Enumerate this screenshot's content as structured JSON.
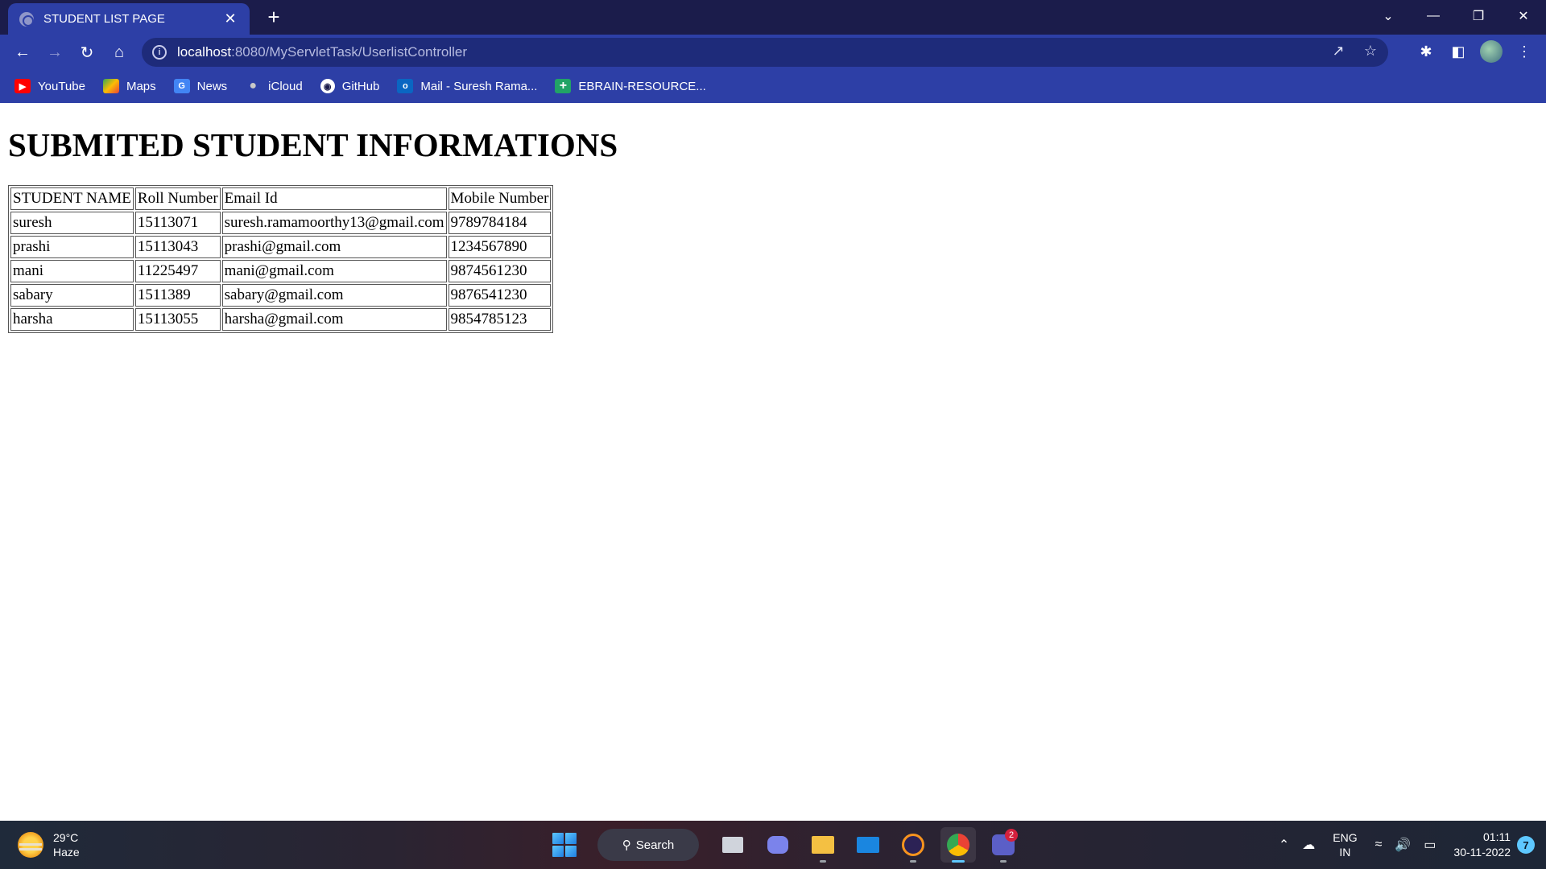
{
  "browser": {
    "tab_title": "STUDENT LIST PAGE",
    "tab_close": "✕",
    "new_tab": "+",
    "url_host": "localhost",
    "url_path": ":8080/MyServletTask/UserlistController"
  },
  "bookmarks": [
    {
      "label": "YouTube",
      "icon": "youtube-icon",
      "color": "#ff0000"
    },
    {
      "label": "Maps",
      "icon": "maps-icon",
      "color": "#34a853"
    },
    {
      "label": "News",
      "icon": "news-icon",
      "color": "#4285f4"
    },
    {
      "label": "iCloud",
      "icon": "apple-icon",
      "color": "#9aa0a6"
    },
    {
      "label": "GitHub",
      "icon": "github-icon",
      "color": "#ffffff"
    },
    {
      "label": "Mail - Suresh Rama...",
      "icon": "outlook-icon",
      "color": "#0a66c2"
    },
    {
      "label": "EBRAIN-RESOURCE...",
      "icon": "plus-green-icon",
      "color": "#21a366"
    }
  ],
  "page": {
    "heading": "SUBMITED STUDENT INFORMATIONS",
    "table": {
      "headers": [
        "STUDENT NAME",
        "Roll Number",
        "Email Id",
        "Mobile Number"
      ],
      "rows": [
        [
          "suresh",
          "15113071",
          "suresh.ramamoorthy13@gmail.com",
          "9789784184"
        ],
        [
          "prashi",
          "15113043",
          "prashi@gmail.com",
          "1234567890"
        ],
        [
          "mani",
          "11225497",
          "mani@gmail.com",
          "9874561230"
        ],
        [
          "sabary",
          "1511389",
          "sabary@gmail.com",
          "9876541230"
        ],
        [
          "harsha",
          "15113055",
          "harsha@gmail.com",
          "9854785123"
        ]
      ]
    }
  },
  "taskbar": {
    "weather_temp": "29°C",
    "weather_desc": "Haze",
    "search_label": "Search",
    "teams_badge": "2",
    "lang_1": "ENG",
    "lang_2": "IN",
    "time": "01:11",
    "date": "30-11-2022",
    "notification_count": "7"
  }
}
